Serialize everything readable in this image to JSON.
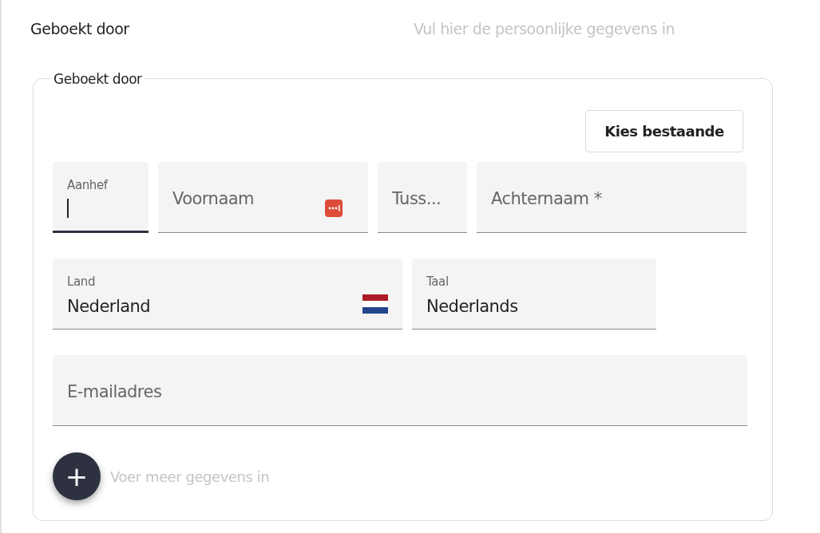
{
  "header": {
    "title": "Geboekt door",
    "hint": "Vul hier de persoonlijke gegevens in"
  },
  "section": {
    "legend": "Geboekt door",
    "choose_button": "Kies bestaande",
    "rows": [
      [
        {
          "label": "Aanhef",
          "focused": true,
          "kind": "text"
        },
        {
          "label": "Voornaam",
          "focused": false,
          "kind": "password-manager"
        },
        {
          "label": "Tuss...",
          "focused": false,
          "kind": "text"
        },
        {
          "label": "Achternaam *",
          "focused": false,
          "kind": "text"
        }
      ],
      [
        {
          "label": "Land",
          "value": "Nederland",
          "focused": false,
          "kind": "country"
        },
        {
          "label": "Taal",
          "value": "Nederlands",
          "focused": false,
          "kind": "text"
        }
      ],
      [
        {
          "label": "E-mailadres",
          "focused": false,
          "kind": "text"
        }
      ]
    ],
    "add_button": "+",
    "add_hint": "Voer meer gegevens in"
  }
}
